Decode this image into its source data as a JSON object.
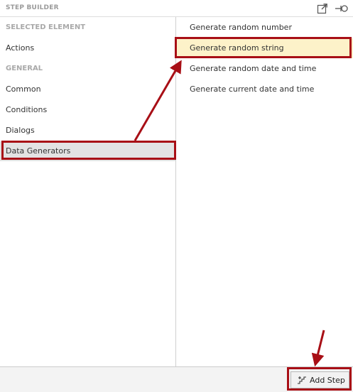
{
  "header": {
    "title": "STEP BUILDER",
    "icons": [
      "popout-icon",
      "pin-icon"
    ]
  },
  "left_panel": {
    "selected_element_heading": "SELECTED ELEMENT",
    "actions_label": "Actions",
    "general_heading": "GENERAL",
    "common_label": "Common",
    "conditions_label": "Conditions",
    "dialogs_label": "Dialogs",
    "data_generators_label": "Data Generators"
  },
  "right_panel": {
    "items": [
      "Generate random number",
      "Generate random string",
      "Generate random date and time",
      "Generate current date and time"
    ]
  },
  "footer": {
    "add_step_label": "Add Step"
  },
  "annotation_color": "#a80f16",
  "highlight_color": "#fdf2c9",
  "selected_color": "#e3e3e3"
}
